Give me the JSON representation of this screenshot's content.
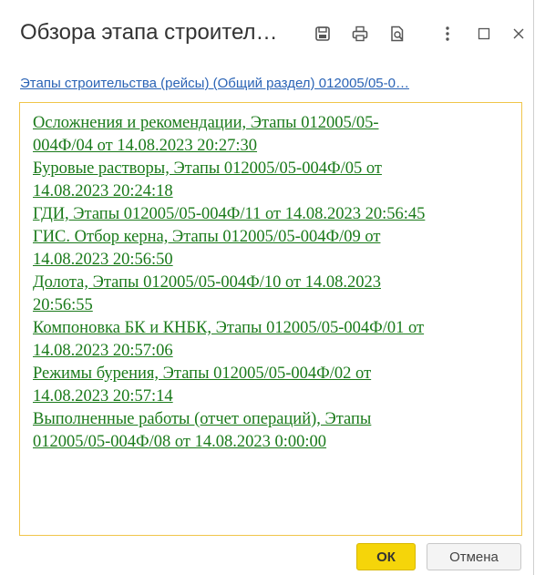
{
  "window": {
    "title": "Обзора этапа строител…",
    "subtitle": "Этапы строительства (рейсы) (Общий раздел) 012005/05-0…"
  },
  "header_icons": {
    "save": "save-icon",
    "print": "print-icon",
    "preview": "print-preview-icon",
    "more": "more-vertical-icon",
    "maximize": "maximize-icon",
    "close": "close-icon"
  },
  "links": [
    {
      "line1": "Осложнения и рекомендации, Этапы 012005/05-",
      "line2": "004Ф/04 от 14.08.2023 20:27:30"
    },
    {
      "line1": "Буровые растворы, Этапы 012005/05-004Ф/05 от",
      "line2": "14.08.2023 20:24:18"
    },
    {
      "line1": "ГДИ, Этапы 012005/05-004Ф/11 от 14.08.2023 20:56:45",
      "line2": ""
    },
    {
      "line1": "ГИС. Отбор керна, Этапы 012005/05-004Ф/09 от",
      "line2": "14.08.2023 20:56:50"
    },
    {
      "line1": "Долота, Этапы 012005/05-004Ф/10 от 14.08.2023",
      "line2": "20:56:55"
    },
    {
      "line1": "Компоновка БК и КНБК, Этапы 012005/05-004Ф/01 от",
      "line2": "14.08.2023 20:57:06"
    },
    {
      "line1": "Режимы бурения, Этапы 012005/05-004Ф/02 от",
      "line2": "14.08.2023 20:57:14"
    },
    {
      "line1": "Выполненные работы (отчет операций), Этапы",
      "line2": "012005/05-004Ф/08 от 14.08.2023 0:00:00"
    }
  ],
  "buttons": {
    "ok_label": "ОК",
    "cancel_label": "Отмена"
  },
  "colors": {
    "link": "#1a7a1a",
    "subtitle_link": "#2a63b5",
    "ok_button": "#f5d50a",
    "content_border": "#f0c54a"
  }
}
